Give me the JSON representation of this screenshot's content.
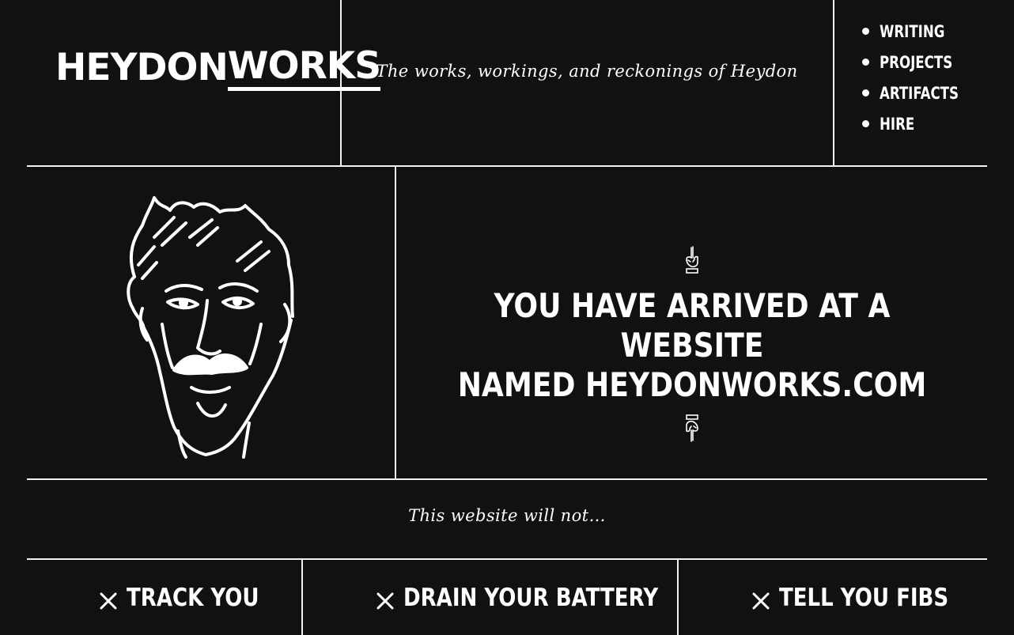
{
  "header": {
    "logo_part1": "HEYDON",
    "logo_part2": "WORKS",
    "tagline": "The works, workings, and reckonings of Heydon"
  },
  "nav": {
    "items": [
      {
        "label": "Writing"
      },
      {
        "label": "Projects"
      },
      {
        "label": "Artifacts"
      },
      {
        "label": "Hire"
      }
    ]
  },
  "hero": {
    "headline_line1": "You have arrived at a website",
    "headline_line2": "named heydonworks.com",
    "icons": [
      "hand-pointing-up-icon",
      "hand-pointing-down-icon"
    ]
  },
  "will_not": {
    "intro": "This website will not…",
    "items": [
      {
        "label": "Track you",
        "icon": "cross-icon"
      },
      {
        "label": "Drain your battery",
        "icon": "cross-icon"
      },
      {
        "label": "Tell you fibs",
        "icon": "cross-icon"
      }
    ]
  },
  "colors": {
    "background": "#111111",
    "foreground": "#ffffff"
  }
}
